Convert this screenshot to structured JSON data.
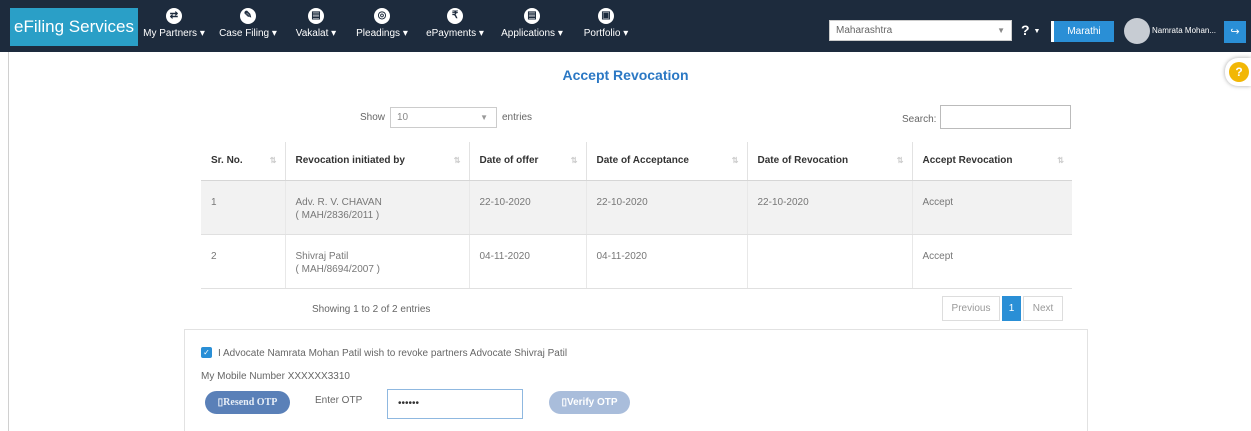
{
  "brand": "eFiling Services",
  "nav": [
    {
      "label": "My Partners",
      "icon": "partners-icon",
      "glyph": "⇄"
    },
    {
      "label": "Case Filing",
      "icon": "case-filing-icon",
      "glyph": "✎"
    },
    {
      "label": "Vakalat",
      "icon": "vakalat-icon",
      "glyph": "▤"
    },
    {
      "label": "Pleadings",
      "icon": "pleadings-icon",
      "glyph": "◎"
    },
    {
      "label": "ePayments",
      "icon": "rupee-icon",
      "glyph": "₹"
    },
    {
      "label": "Applications",
      "icon": "applications-icon",
      "glyph": "▤"
    },
    {
      "label": "Portfolio",
      "icon": "portfolio-icon",
      "glyph": "▣"
    }
  ],
  "header": {
    "state_select": "Maharashtra",
    "help": "?",
    "language_button": "Marathi",
    "username": "Namrata Mohan...",
    "logout_glyph": "↪",
    "float_help": "?"
  },
  "page_title": "Accept Revocation",
  "table_controls": {
    "show_label": "Show",
    "page_size": "10",
    "entries_label": "entries",
    "search_label": "Search:"
  },
  "columns": [
    "Sr. No.",
    "Revocation initiated by",
    "Date of offer",
    "Date of Acceptance",
    "Date of Revocation",
    "Accept Revocation"
  ],
  "rows": [
    {
      "sr": "1",
      "name": "Adv. R. V. CHAVAN",
      "code": "( MAH/2836/2011 )",
      "offer": "22-10-2020",
      "acceptance": "22-10-2020",
      "revocation": "22-10-2020",
      "action": "Accept"
    },
    {
      "sr": "2",
      "name": "Shivraj Patil",
      "code": "( MAH/8694/2007 )",
      "offer": "04-11-2020",
      "acceptance": "04-11-2020",
      "revocation": "",
      "action": "Accept"
    }
  ],
  "table_info": "Showing 1 to 2 of 2 entries",
  "pagination": {
    "previous": "Previous",
    "current": "1",
    "next": "Next"
  },
  "otp_panel": {
    "declaration": "I Advocate Namrata Mohan Patil wish to revoke partners Advocate Shivraj Patil",
    "mobile": "My Mobile Number XXXXXX3310",
    "resend_label": "Resend OTP",
    "enter_otp_label": "Enter OTP",
    "otp_value": "••••••",
    "verify_label": "Verify OTP"
  },
  "colors": {
    "nav_bg": "#1d2b3d",
    "brand_bg": "#2a9fc7",
    "accent": "#2a8fd6",
    "title": "#2b78c4"
  }
}
